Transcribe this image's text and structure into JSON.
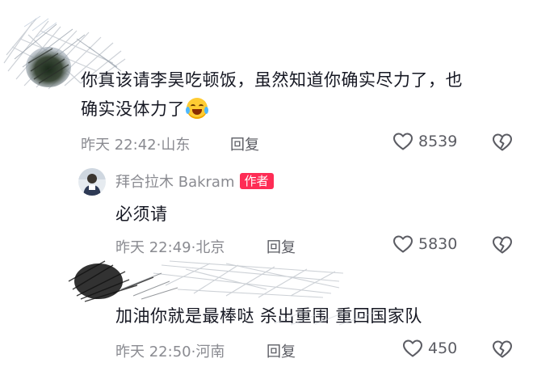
{
  "comments": [
    {
      "text_line1": "你真该请李昊吃顿饭，虽然知道你确实尽力了，也",
      "text_line2": "确实没体力了",
      "emoji": "crying-laughing",
      "time": "昨天 22:42",
      "location": "山东",
      "reply_label": "回复",
      "likes": "8539"
    },
    {
      "author": "拜合拉木 Bakram",
      "author_badge": "作者",
      "text": "必须请",
      "time": "昨天 22:49",
      "location": "北京",
      "reply_label": "回复",
      "likes": "5830"
    },
    {
      "text": "加油你就是最棒哒 杀出重围 重回国家队",
      "time": "昨天 22:50",
      "location": "河南",
      "reply_label": "回复",
      "likes": "450"
    }
  ],
  "meta_separator": "·",
  "colors": {
    "badge": "#fe2c55",
    "text": "#161823",
    "meta": "#8a8b91"
  }
}
